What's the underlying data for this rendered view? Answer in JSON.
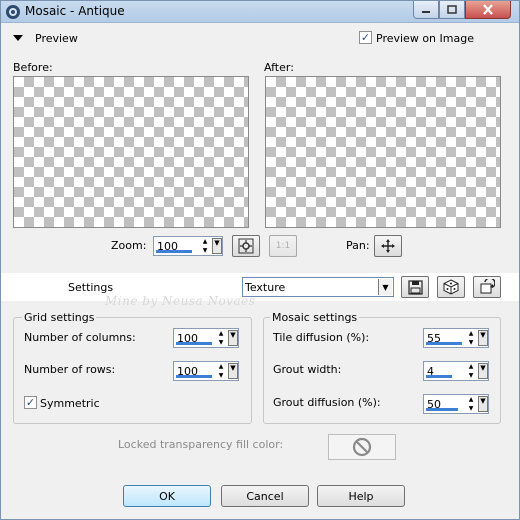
{
  "window": {
    "title": "Mosaic - Antique"
  },
  "preview": {
    "header_label": "Preview",
    "preview_on_image_label": "Preview on Image",
    "preview_on_image_checked": true,
    "before_label": "Before:",
    "after_label": "After:",
    "zoom_label": "Zoom:",
    "zoom_value": "100",
    "zoom_actual_label": "1:1",
    "pan_label": "Pan:"
  },
  "settings": {
    "label": "Settings",
    "preset_value": "Texture",
    "watermark": "Mine by Neusa Novaes"
  },
  "grid_settings": {
    "title": "Grid settings",
    "columns_label": "Number of columns:",
    "columns_value": "100",
    "rows_label": "Number of rows:",
    "rows_value": "100",
    "symmetric_label": "Symmetric",
    "symmetric_checked": true
  },
  "mosaic_settings": {
    "title": "Mosaic settings",
    "tile_diffusion_label": "Tile diffusion (%):",
    "tile_diffusion_value": "55",
    "grout_width_label": "Grout width:",
    "grout_width_value": "4",
    "grout_diffusion_label": "Grout diffusion (%):",
    "grout_diffusion_value": "50"
  },
  "locked": {
    "label": "Locked transparency fill color:"
  },
  "buttons": {
    "ok": "OK",
    "cancel": "Cancel",
    "help": "Help"
  },
  "icons": {
    "app": "paint-shop-icon",
    "minimize": "minimize-icon",
    "maximize": "maximize-icon",
    "close": "close-icon",
    "collapse": "triangle-down-icon",
    "zoom_fit": "zoom-fit-icon",
    "pan": "move-cross-icon",
    "save_preset": "floppy-disk-icon",
    "randomize": "dice-icon",
    "reset": "reset-icon",
    "no_color": "no-symbol-icon"
  },
  "colors": {
    "title_bar": "#b9cfe8",
    "close_button": "#c75050",
    "default_button": "#bee6fd",
    "value_underline": "#3c7fd5"
  }
}
